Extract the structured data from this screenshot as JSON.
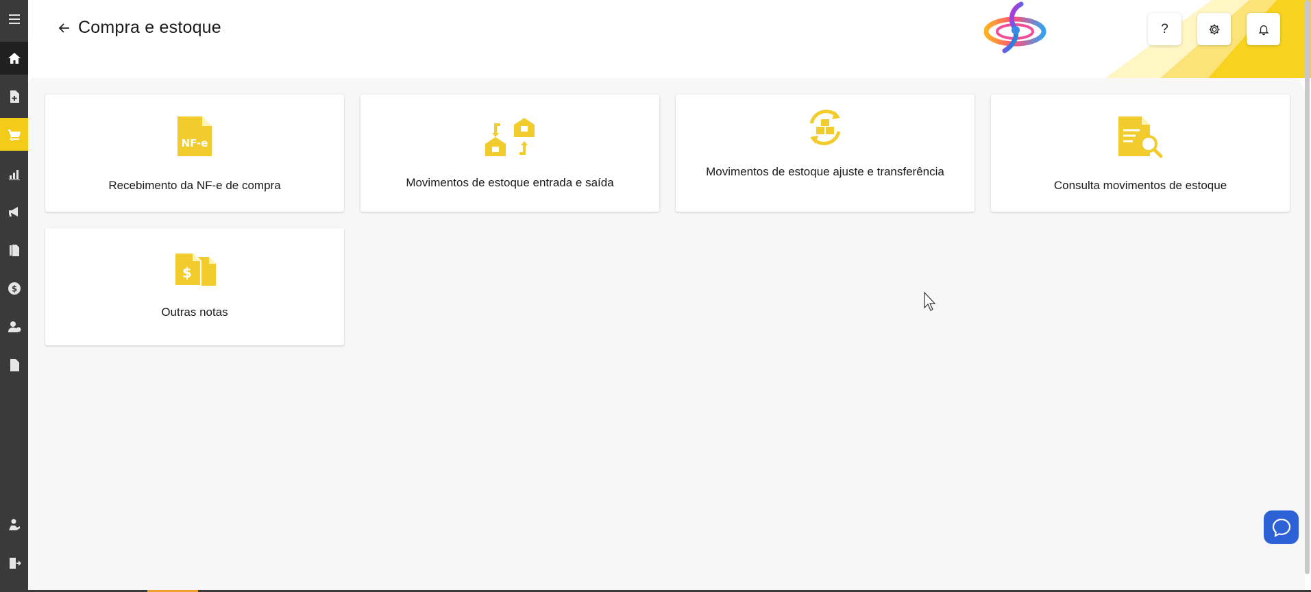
{
  "header": {
    "title": "Compra e estoque",
    "help_label": "?"
  },
  "sidebar": {
    "items": [
      {
        "icon": "menu-icon"
      },
      {
        "icon": "home-icon"
      },
      {
        "icon": "document-plus-icon"
      },
      {
        "icon": "cart-icon"
      },
      {
        "icon": "chart-icon"
      },
      {
        "icon": "megaphone-icon"
      },
      {
        "icon": "files-icon"
      },
      {
        "icon": "dollar-coin-icon"
      },
      {
        "icon": "user-money-icon"
      },
      {
        "icon": "file-icon"
      },
      {
        "icon": "hand-heart-icon"
      },
      {
        "icon": "logout-icon"
      }
    ]
  },
  "cards": [
    {
      "label": "Recebimento da NF-e de compra",
      "icon": "nfe-document-icon",
      "icon_text": "NF-e"
    },
    {
      "label": "Movimentos de estoque entrada e saída",
      "icon": "warehouse-transfer-icon"
    },
    {
      "label": "Movimentos de estoque ajuste e transferência",
      "icon": "boxes-refresh-icon"
    },
    {
      "label": "Consulta movimentos de estoque",
      "icon": "document-search-icon"
    },
    {
      "label": "Outras notas",
      "icon": "dollar-documents-icon",
      "icon_text": "$"
    }
  ],
  "colors": {
    "accent": "#f2cc18",
    "sidebar": "#3a3a3a",
    "chat": "#2c62d6"
  }
}
